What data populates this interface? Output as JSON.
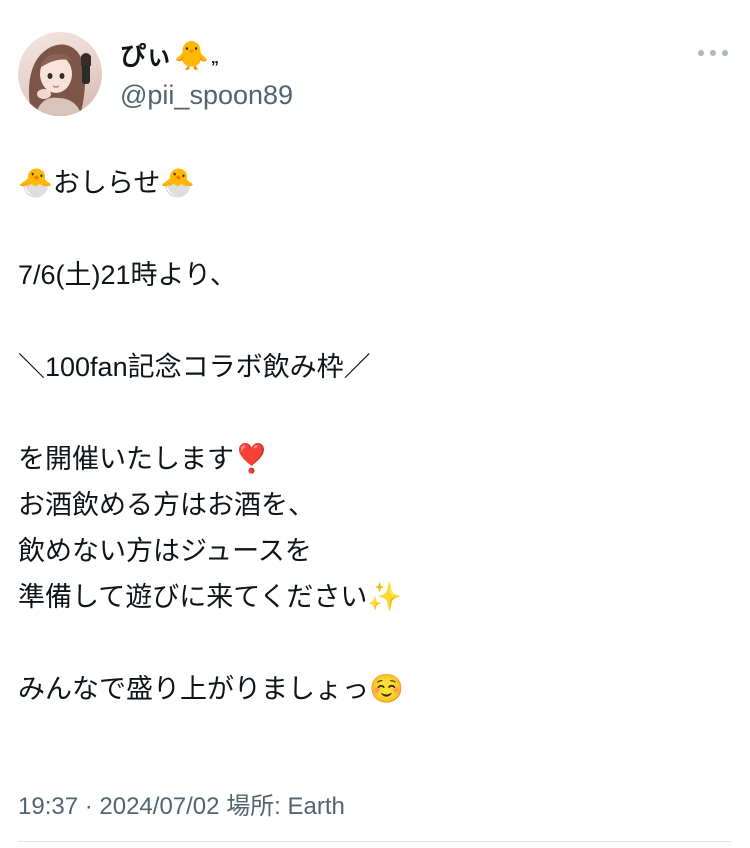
{
  "user": {
    "display_name": "ぴぃ",
    "name_emoji": "🐥",
    "name_suffix": "„",
    "handle": "@pii_spoon89"
  },
  "tweet": {
    "title_left_emoji": "🐣",
    "title_text": "おしらせ",
    "title_right_emoji": "🐣",
    "date_line": "7/6(土)21時より、",
    "event_line": "＼100fan記念コラボ飲み枠／",
    "line_hold_text": "を開催いたします",
    "line_hold_emoji": "❣️",
    "line_drink": "お酒飲める方はお酒を、",
    "line_juice": "飲めない方はジュースを",
    "line_prepare_text": "準備して遊びに来てください",
    "line_prepare_emoji": "✨",
    "line_enjoy_text": "みんなで盛り上がりましょっ",
    "line_enjoy_emoji": "☺️"
  },
  "meta": {
    "timestamp": "19:37 · 2024/07/02",
    "location_label": "場所:",
    "location_value": "Earth"
  },
  "icons": {
    "more": "more-options-icon",
    "avatar": "avatar-image"
  },
  "colors": {
    "text": "#0f1419",
    "secondary": "#536471",
    "divider": "#e1e8ed"
  }
}
